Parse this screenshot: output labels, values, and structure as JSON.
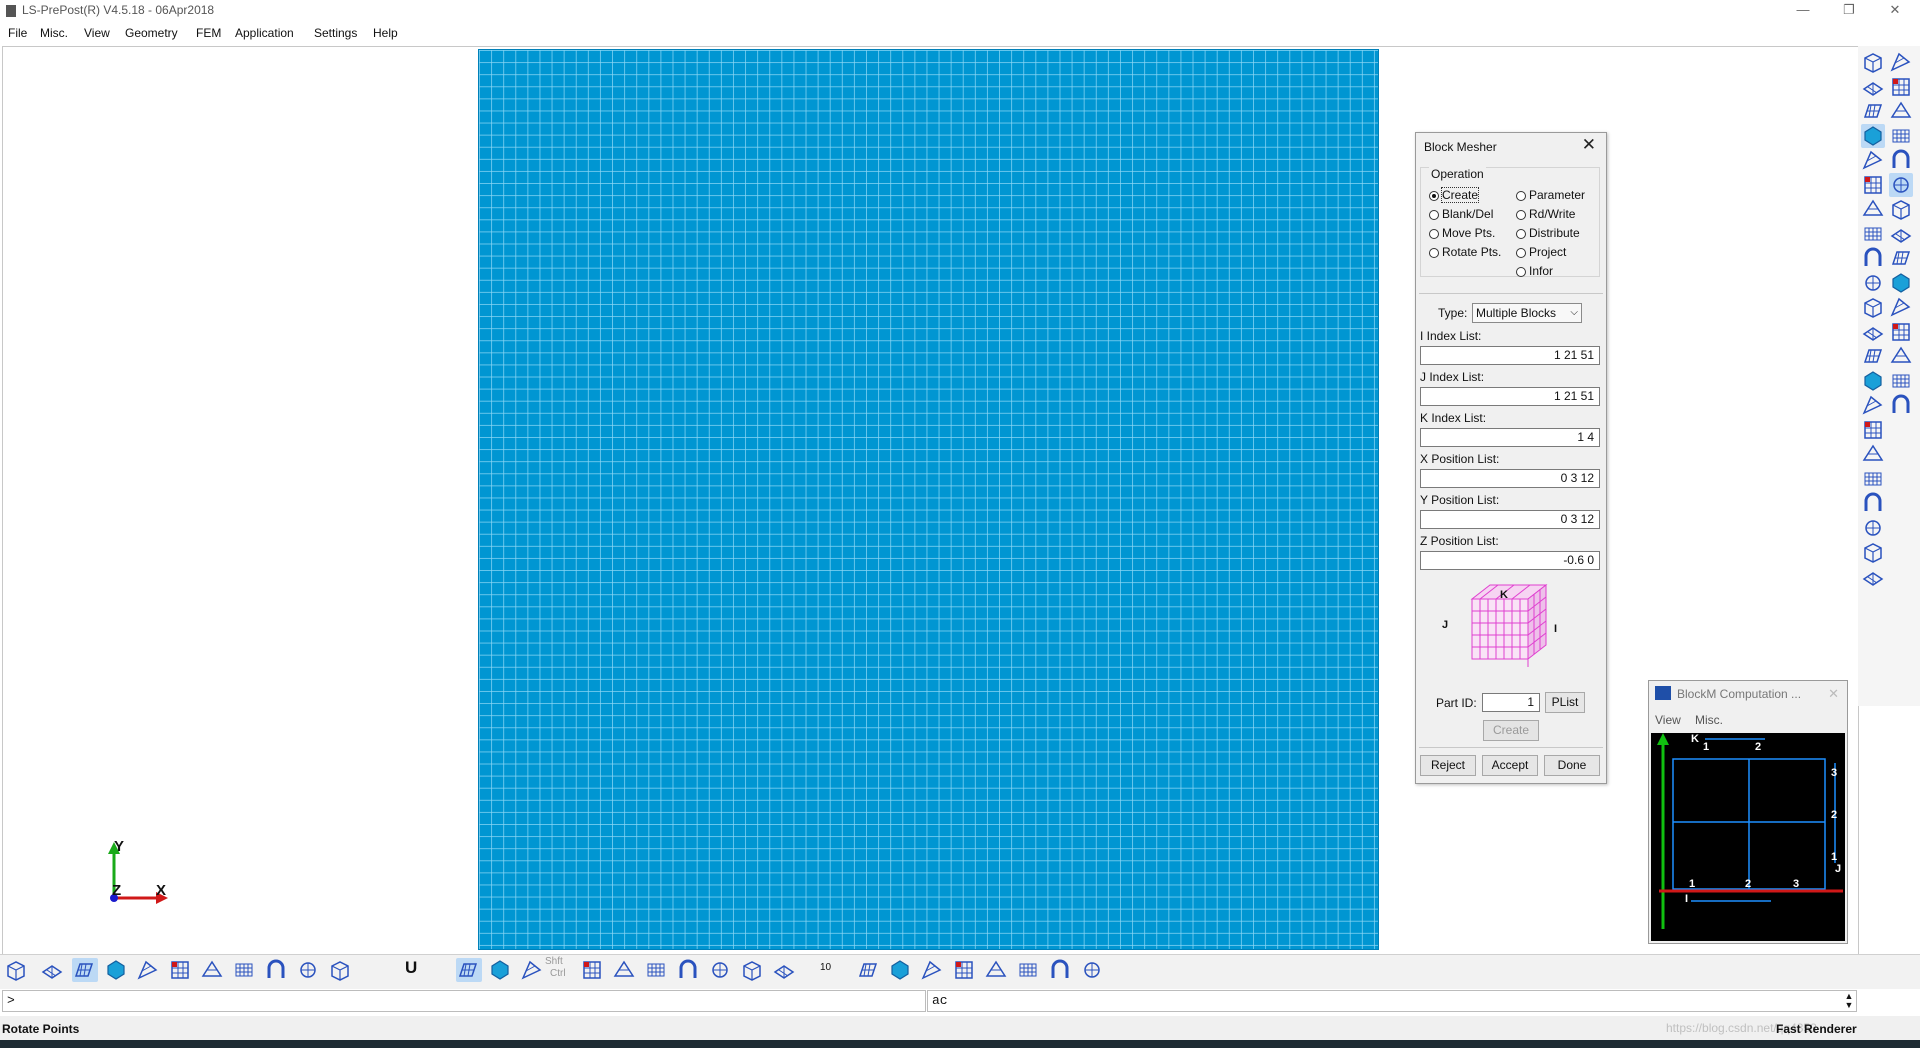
{
  "window": {
    "title": "LS-PrePost(R) V4.5.18 - 06Apr2018",
    "minimize_glyph": "—",
    "restore_glyph": "❐",
    "close_glyph": "✕"
  },
  "menu": [
    "File",
    "Misc.",
    "View",
    "Geometry",
    "FEM",
    "Application",
    "Settings",
    "Help"
  ],
  "axis_triad": {
    "y": "Y",
    "x": "X",
    "z": "Z"
  },
  "block_mesher": {
    "title": "Block Mesher",
    "close_glyph": "✕",
    "operation_label": "Operation",
    "operations_left": [
      "Create",
      "Blank/Del",
      "Move Pts.",
      "Rotate Pts."
    ],
    "operations_right": [
      "Parameter",
      "Rd/Write",
      "Distribute",
      "Project",
      "Infor"
    ],
    "selected_operation": "Create",
    "type_label": "Type:",
    "type_value": "Multiple Blocks",
    "i_index_label": "I Index List:",
    "i_index_value": "1 21 51",
    "j_index_label": "J Index List:",
    "j_index_value": "1 21 51",
    "k_index_label": "K Index List:",
    "k_index_value": "1 4",
    "x_pos_label": "X Position List:",
    "x_pos_value": "0 3 12",
    "y_pos_label": "Y Position List:",
    "y_pos_value": "0 3 12",
    "z_pos_label": "Z Position List:",
    "z_pos_value": "-0.6 0",
    "cube_labels": {
      "k": "K",
      "j": "J",
      "i": "I"
    },
    "part_id_label": "Part ID:",
    "part_id_value": "1",
    "plist_button": "PList",
    "create_button": "Create",
    "reject_button": "Reject",
    "accept_button": "Accept",
    "done_button": "Done"
  },
  "computation_window": {
    "title": "BlockM Computation ...",
    "close_glyph": "✕",
    "menu": [
      "View",
      "Misc."
    ],
    "labels": {
      "k": "K",
      "j": "J",
      "i": "I",
      "top": [
        "1",
        "2"
      ],
      "right": [
        "3",
        "2",
        "1"
      ],
      "bottom": [
        "1",
        "2",
        "3"
      ]
    }
  },
  "bottom_toolbar": {
    "u_label": "U",
    "shft_ctrl": [
      "Shft",
      "Ctrl"
    ],
    "number": "10"
  },
  "command_line": {
    "prompt": ">",
    "right_value": "ac"
  },
  "status_bar": {
    "left": "Rotate Points",
    "right": "Fast Renderer",
    "watermark": "https://blog.csdn.net/qq4353"
  },
  "colors": {
    "mesh_fill": "#0096d2",
    "mesh_lines": "#8cd7f5",
    "magenta_cube": "#e040d0",
    "accent_blue": "#1f4fa8"
  }
}
